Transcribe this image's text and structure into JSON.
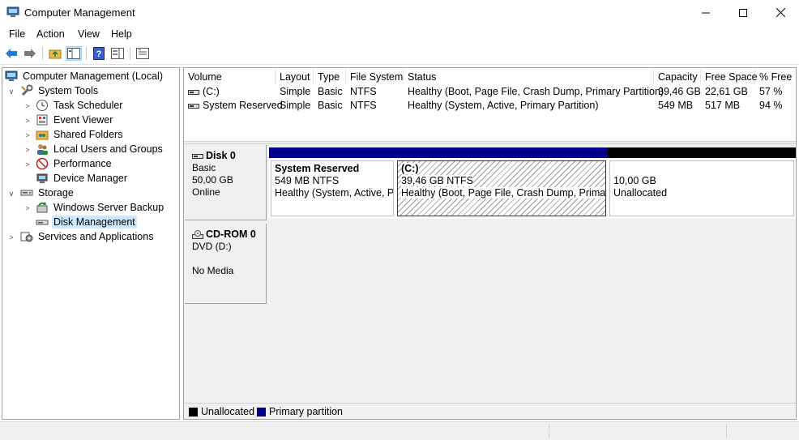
{
  "window": {
    "title": "Computer Management"
  },
  "menu": [
    "File",
    "Action",
    "View",
    "Help"
  ],
  "tree": {
    "root": "Computer Management (Local)",
    "items": [
      {
        "label": "System Tools",
        "icon": "tools-icon"
      },
      {
        "label": "Task Scheduler",
        "icon": "clock-icon"
      },
      {
        "label": "Event Viewer",
        "icon": "event-viewer-icon"
      },
      {
        "label": "Shared Folders",
        "icon": "shared-folder-icon"
      },
      {
        "label": "Local Users and Groups",
        "icon": "users-icon"
      },
      {
        "label": "Performance",
        "icon": "performance-icon"
      },
      {
        "label": "Device Manager",
        "icon": "device-manager-icon"
      },
      {
        "label": "Storage",
        "icon": "storage-icon"
      },
      {
        "label": "Windows Server Backup",
        "icon": "backup-icon"
      },
      {
        "label": "Disk Management",
        "icon": "disk-icon"
      },
      {
        "label": "Services and Applications",
        "icon": "services-icon"
      }
    ]
  },
  "volumes": {
    "columns": [
      "Volume",
      "Layout",
      "Type",
      "File System",
      "Status",
      "Capacity",
      "Free Space",
      "% Free"
    ],
    "rows": [
      {
        "volume": "(C:)",
        "layout": "Simple",
        "type": "Basic",
        "fs": "NTFS",
        "status": "Healthy (Boot, Page File, Crash Dump, Primary Partition)",
        "capacity": "39,46 GB",
        "free": "22,61 GB",
        "pct": "57 %"
      },
      {
        "volume": "System Reserved",
        "layout": "Simple",
        "type": "Basic",
        "fs": "NTFS",
        "status": "Healthy (System, Active, Primary Partition)",
        "capacity": "549 MB",
        "free": "517 MB",
        "pct": "94 %"
      }
    ]
  },
  "disks": [
    {
      "name": "Disk 0",
      "type": "Basic",
      "size": "50,00 GB",
      "state": "Online",
      "partitions": [
        {
          "title": "System Reserved",
          "size": "549 MB NTFS",
          "status": "Healthy (System, Active, Pr"
        },
        {
          "title": "(C:)",
          "size": "39,46 GB NTFS",
          "status": "Healthy (Boot, Page File, Crash Dump, Primary"
        },
        {
          "title": "",
          "size": "10,00 GB",
          "status": "Unallocated"
        }
      ]
    },
    {
      "name": "CD-ROM 0",
      "type": "DVD (D:)",
      "media": "No Media"
    }
  ],
  "legend": {
    "unallocated": "Unallocated",
    "primary": "Primary partition"
  },
  "colors": {
    "primary_bar": "#00008b",
    "unallocated_bar": "#000000",
    "selection": "#cce8ff"
  }
}
